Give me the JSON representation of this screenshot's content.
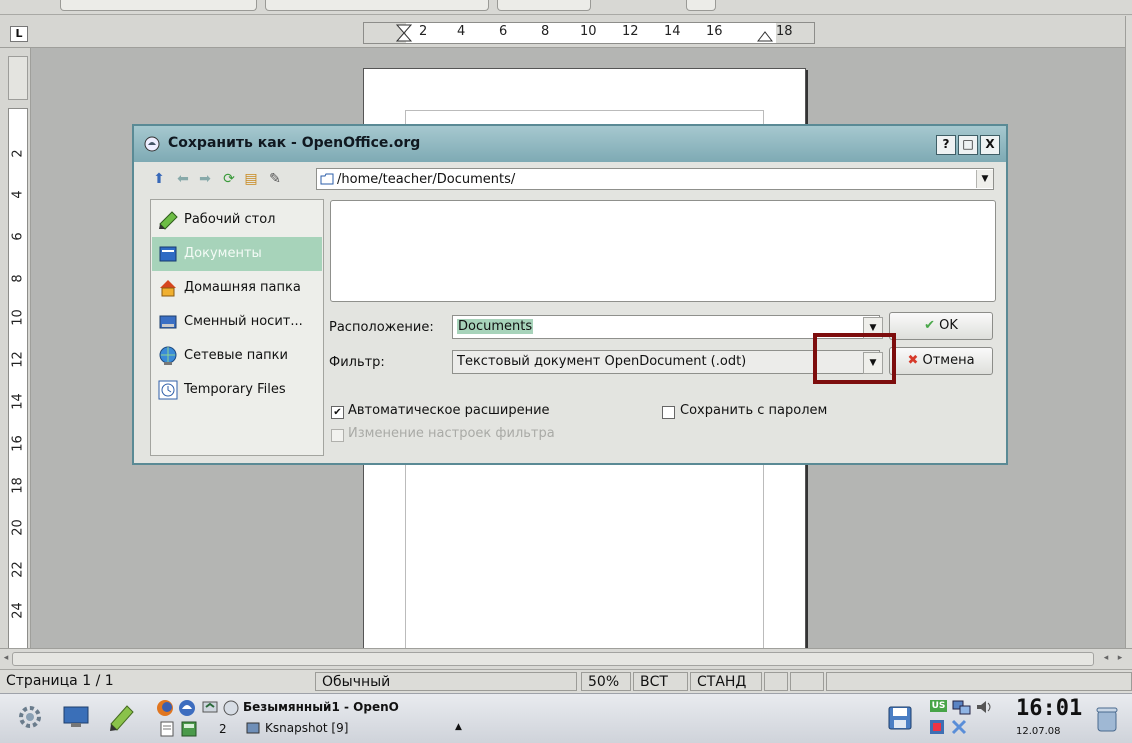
{
  "ruler": {
    "corner": "L",
    "h_ticks": [
      "2",
      "4",
      "6",
      "8",
      "10",
      "12",
      "14",
      "16",
      "18"
    ],
    "v_ticks": [
      "2",
      "4",
      "6",
      "8",
      "10",
      "12",
      "14",
      "16",
      "18",
      "20",
      "22",
      "24"
    ]
  },
  "dialog": {
    "title": "Сохранить как - OpenOffice.org",
    "buttons": {
      "help": "?",
      "maximize": "□",
      "close": "X"
    },
    "path": "/home/teacher/Documents/",
    "places": [
      {
        "label": "Рабочий стол",
        "icon": "desktop-icon"
      },
      {
        "label": "Документы",
        "icon": "documents-icon",
        "selected": true
      },
      {
        "label": "Домашняя папка",
        "icon": "home-icon"
      },
      {
        "label": "Сменный носит...",
        "icon": "removable-drive-icon"
      },
      {
        "label": "Сетевые папки",
        "icon": "network-icon"
      },
      {
        "label": "Temporary Files",
        "icon": "clock-icon"
      }
    ],
    "location_label": "Расположение:",
    "location_value": "Documents",
    "filter_label": "Фильтр:",
    "filter_value": "Текстовый документ OpenDocument (.odt)",
    "ok_label": "OK",
    "cancel_label": "Отмена",
    "auto_ext_label": "Автоматическое расширение",
    "auto_ext_checked": true,
    "password_label": "Сохранить с паролем",
    "password_checked": false,
    "filter_settings_label": "Изменение настроек фильтра",
    "filter_settings_checked": false
  },
  "statusbar": {
    "page": "Страница 1 / 1",
    "style": "Обычный",
    "zoom": "50%",
    "insert": "ВСТ",
    "select": "СТАНД"
  },
  "taskbar": {
    "desktop_count": "2",
    "task1": "Безымянный1 - OpenO",
    "task2": "Ksnapshot [9]",
    "keyboard": "US",
    "clock": "16:01",
    "date": "12.07.08"
  },
  "colors": {
    "titlebar": "#7eaab4",
    "selection": "#a7d3ba",
    "highlight": "#7d0d0d"
  }
}
